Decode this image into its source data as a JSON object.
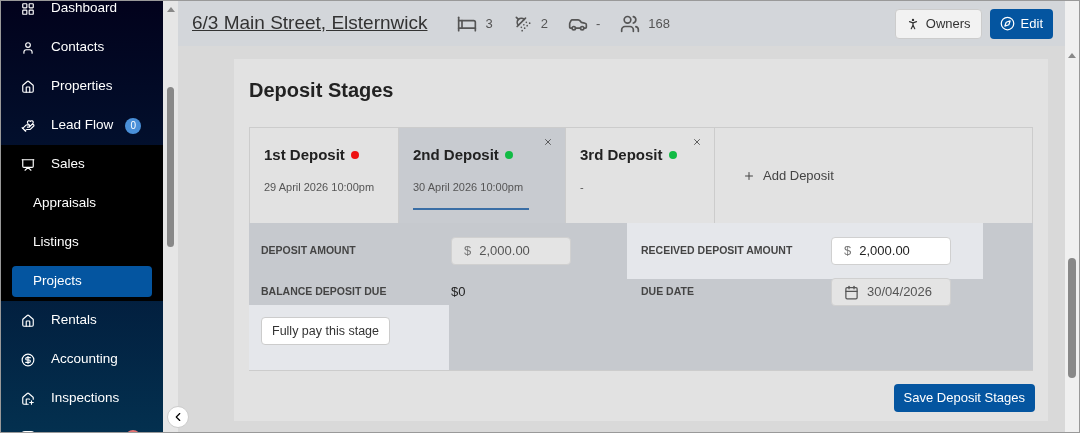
{
  "sidebar": {
    "items": [
      {
        "label": "Dashboard",
        "expanded": false
      },
      {
        "label": "Contacts",
        "expanded": false
      },
      {
        "label": "Properties",
        "expanded": false
      },
      {
        "label": "Lead Flow",
        "expanded": false,
        "badge": "0"
      },
      {
        "label": "Sales",
        "expanded": true,
        "children": [
          {
            "label": "Appraisals",
            "selected": false
          },
          {
            "label": "Listings",
            "selected": false
          },
          {
            "label": "Projects",
            "selected": true
          }
        ]
      },
      {
        "label": "Rentals",
        "expanded": false
      },
      {
        "label": "Accounting",
        "expanded": false
      },
      {
        "label": "Inspections",
        "expanded": false
      }
    ]
  },
  "header": {
    "title": "6/3 Main Street, Elsternwick",
    "stats": [
      "3",
      "2",
      "-",
      "168"
    ],
    "buttons": [
      "Owners",
      "Edit"
    ]
  },
  "deposit_stages": {
    "title": "Deposit Stages",
    "tabs": [
      {
        "title": "1st Deposit",
        "color": "#ee1111",
        "date": "29 April 2026 10:00pm",
        "selected": false,
        "closable": false
      },
      {
        "title": "2nd Deposit",
        "color": "#11bb44",
        "date": "30 April 2026 10:00pm",
        "selected": true,
        "closable": true
      },
      {
        "title": "3rd Deposit",
        "color": "#11bb44",
        "date": "-",
        "selected": false,
        "closable": true
      }
    ],
    "add_label": "Add Deposit",
    "deposit_amount": {
      "label": "DEPOSIT AMOUNT",
      "prefix": "$",
      "value": "2,000.00",
      "disabled": true
    },
    "received_amount": {
      "label": "RECEIVED DEPOSIT AMOUNT",
      "prefix": "$",
      "value": "2,000.00",
      "disabled": false
    },
    "balance": {
      "label": "BALANCE DEPOSIT DUE",
      "value": "$0"
    },
    "due_date": {
      "label": "DUE DATE",
      "value": "30/04/2026",
      "disabled": true
    },
    "pay_button": "Fully pay this stage",
    "save_button": "Save Deposit Stages"
  }
}
